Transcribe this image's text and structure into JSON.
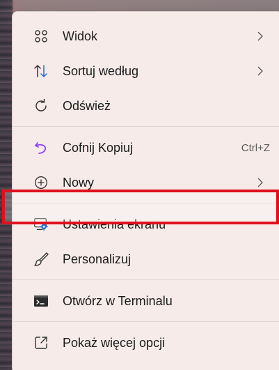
{
  "menu": {
    "items": [
      {
        "id": "view",
        "label": "Widok",
        "icon": "grid-icon",
        "submenu": true
      },
      {
        "id": "sort",
        "label": "Sortuj według",
        "icon": "sort-arrows-icon",
        "submenu": true
      },
      {
        "id": "refresh",
        "label": "Odśwież",
        "icon": "refresh-icon",
        "submenu": false
      },
      {
        "id": "undo",
        "label": "Cofnij Kopiuj",
        "icon": "undo-icon",
        "shortcut": "Ctrl+Z"
      },
      {
        "id": "new",
        "label": "Nowy",
        "icon": "plus-circle-icon",
        "submenu": true
      },
      {
        "id": "display",
        "label": "Ustawienia ekranu",
        "icon": "display-settings-icon",
        "submenu": false,
        "highlighted": true
      },
      {
        "id": "personalize",
        "label": "Personalizuj",
        "icon": "brush-icon",
        "submenu": false
      },
      {
        "id": "terminal",
        "label": "Otwórz w Terminalu",
        "icon": "terminal-icon",
        "submenu": false
      },
      {
        "id": "more",
        "label": "Pokaż więcej opcji",
        "icon": "more-options-icon",
        "submenu": false
      }
    ]
  },
  "colors": {
    "menu_bg": "#f6ebe9",
    "accent_blue": "#1f6fd1",
    "highlight_red": "#e0101e",
    "undo_purple": "#8a3ffc"
  }
}
